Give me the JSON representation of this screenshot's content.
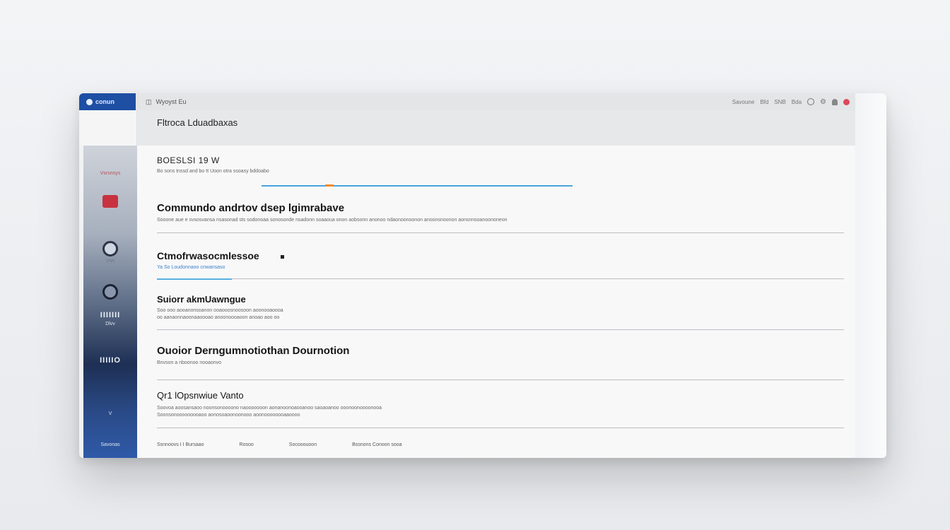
{
  "app": {
    "logo_label": "conun",
    "nav_label": "Wyoyst Eu"
  },
  "topbar": {
    "status_items": [
      "Savoune",
      "Bfd",
      "SNB",
      "Bda"
    ]
  },
  "sidebar": {
    "items": [
      {
        "label": "Vsrsnnys",
        "icon": "vault-icon"
      },
      {
        "label": "",
        "icon": "shield-icon"
      },
      {
        "label": "Vsn",
        "icon": "ring-icon"
      },
      {
        "label": "",
        "icon": "ring-icon"
      },
      {
        "label": "IIIIIII",
        "big": "Dlvv"
      },
      {
        "label": "",
        "big": "IIIIIO"
      },
      {
        "label": "",
        "big": "V"
      },
      {
        "label": "Savonas"
      }
    ]
  },
  "page": {
    "title": "Fltroca Lduadbaxas",
    "subsection": "BOESLSI 19 W",
    "subsection_desc": "Bo sons tnssd and bo tt Uoon otra ssoasy bddoabo"
  },
  "sections": [
    {
      "title": "Commundo andrtov dsep lgimrabave",
      "desc": "Sooone aue e svsosvansa nsasonad sts sodonoaa sonosonde nsadonn soaaoua onon aobsonn anonoo ndaonoonoonon anoonsnoonon aonsnnsoanoononeon"
    },
    {
      "title": "Ctmofrwasocmlessoe",
      "desc": "Ya So Loudonnaoo cnwansaso"
    },
    {
      "title": "Suiorr akmUawngue",
      "desc": "Soo ooo aooanonsoanon ooaooosnoosoon aoonooaoooa",
      "desc2": "oo aanaonnaoonaaoooao anoonoooaoon anoao aoo oo"
    },
    {
      "title": "Ouoior Derngumnotiothan Dournotion",
      "desc": "Bnvson a nboonoo nooaonvo"
    },
    {
      "title": "Qr1 lOpsnwiue Vanto",
      "desc": "Soovoa aoosansaoo noonsonoooono naooooooon aonanoonoaooanoo saoaoanoo ooonoonoooonooa",
      "desc2": "Soonsonooooooooaoo aonosoaoonoonooo aoonoooooooaaoooo"
    }
  ],
  "footer": {
    "items": [
      "Ssnnoovs I I Bursaao",
      "Rosoo",
      "Socooouoon",
      "Bssnons Conoon sooa"
    ]
  }
}
